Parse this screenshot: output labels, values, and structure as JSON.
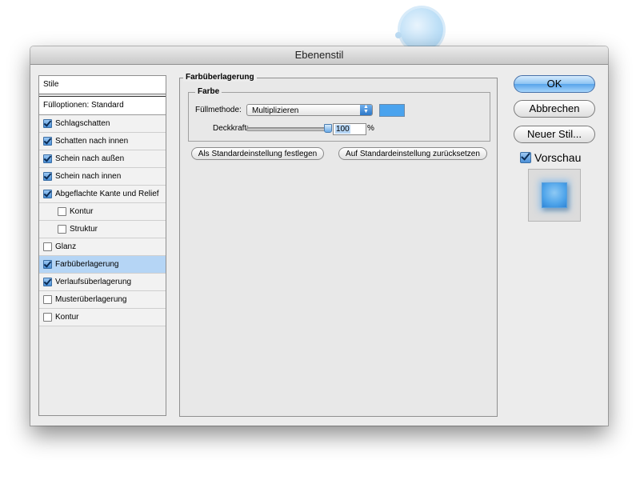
{
  "window": {
    "title": "Ebenenstil"
  },
  "styles_panel": {
    "header": "Stile",
    "blending": "Fülloptionen: Standard",
    "items": [
      {
        "label": "Schlagschatten",
        "checked": true,
        "sub": false,
        "selected": false
      },
      {
        "label": "Schatten nach innen",
        "checked": true,
        "sub": false,
        "selected": false
      },
      {
        "label": "Schein nach außen",
        "checked": true,
        "sub": false,
        "selected": false
      },
      {
        "label": "Schein nach innen",
        "checked": true,
        "sub": false,
        "selected": false
      },
      {
        "label": "Abgeflachte Kante und Relief",
        "checked": true,
        "sub": false,
        "selected": false
      },
      {
        "label": "Kontur",
        "checked": false,
        "sub": true,
        "selected": false
      },
      {
        "label": "Struktur",
        "checked": false,
        "sub": true,
        "selected": false
      },
      {
        "label": "Glanz",
        "checked": false,
        "sub": false,
        "selected": false
      },
      {
        "label": "Farbüberlagerung",
        "checked": true,
        "sub": false,
        "selected": true
      },
      {
        "label": "Verlaufsüberlagerung",
        "checked": true,
        "sub": false,
        "selected": false
      },
      {
        "label": "Musterüberlagerung",
        "checked": false,
        "sub": false,
        "selected": false
      },
      {
        "label": "Kontur",
        "checked": false,
        "sub": false,
        "selected": false
      }
    ]
  },
  "overlay": {
    "title": "Farbüberlagerung",
    "color_group": "Farbe",
    "fill_method_label": "Füllmethode:",
    "fill_method_value": "Multiplizieren",
    "swatch_color": "#4aa3ee",
    "opacity_label": "Deckkraft:",
    "opacity_value": "100",
    "opacity_fraction": 1.0,
    "opacity_unit": "%",
    "make_default": "Als Standardeinstellung festlegen",
    "reset_default": "Auf Standardeinstellung zurücksetzen"
  },
  "buttons": {
    "ok": "OK",
    "cancel": "Abbrechen",
    "new_style": "Neuer Stil...",
    "preview_label": "Vorschau",
    "preview_checked": true
  },
  "colors": {
    "accent": "#4a8fd6",
    "selection": "#b5d5f5"
  }
}
